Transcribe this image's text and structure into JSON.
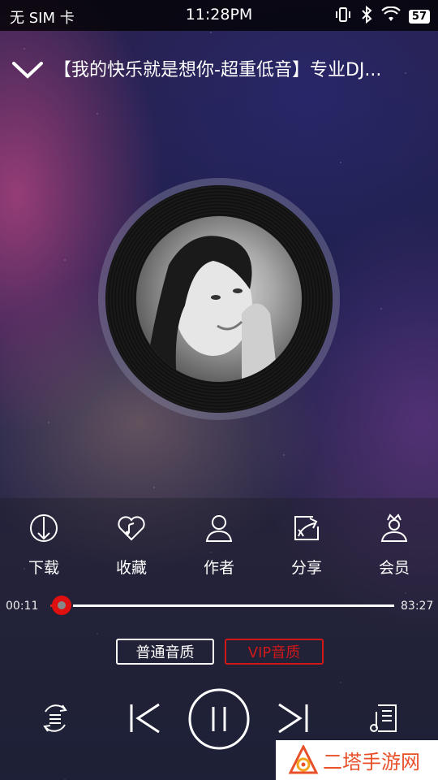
{
  "status_bar": {
    "carrier": "无 SIM 卡",
    "time": "11:28PM",
    "battery": "57"
  },
  "header": {
    "title": "【我的快乐就是想你-超重低音】专业DJ..."
  },
  "actions": [
    {
      "label": "下载",
      "icon": "download-icon"
    },
    {
      "label": "收藏",
      "icon": "favorite-icon"
    },
    {
      "label": "作者",
      "icon": "author-icon"
    },
    {
      "label": "分享",
      "icon": "share-icon"
    },
    {
      "label": "会员",
      "icon": "vip-member-icon"
    }
  ],
  "progress": {
    "current": "00:11",
    "total": "83:27",
    "fraction": 0.002
  },
  "quality": {
    "normal": "普通音质",
    "vip": "VIP音质"
  },
  "watermark": {
    "text": "二塔手游网"
  },
  "colors": {
    "accent_red": "#e01010",
    "watermark_orange": "#e8502a"
  }
}
